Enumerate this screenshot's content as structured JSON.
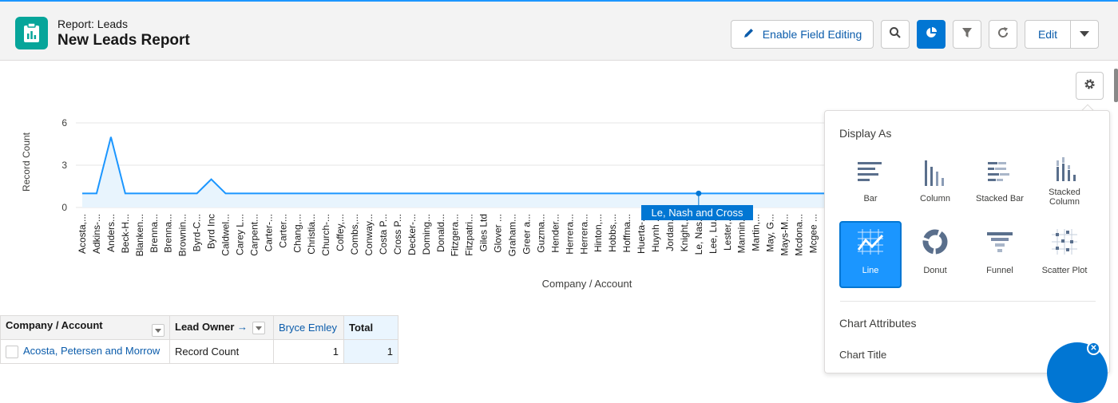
{
  "header": {
    "subtitle": "Report: Leads",
    "title": "New Leads Report",
    "enable_field_editing": "Enable Field Editing",
    "edit": "Edit"
  },
  "chart_data": {
    "type": "line",
    "xlabel": "Company / Account",
    "ylabel": "Record Count",
    "ylim": [
      0,
      6
    ],
    "yticks": [
      0,
      3,
      6
    ],
    "categories": [
      "Acosta,...",
      "Adkins-...",
      "Anders...",
      "Beck-H...",
      "Blanken...",
      "Brenna...",
      "Brenna...",
      "Brownin...",
      "Byrd-C...",
      "Byrd Inc",
      "Caldwel...",
      "Carey L...",
      "Carpent...",
      "Carter-...",
      "Carter...",
      "Chang,...",
      "Christia...",
      "Church-...",
      "Coffey,...",
      "Combs,...",
      "Conway...",
      "Costa P...",
      "Cross P...",
      "Decker-...",
      "Doming...",
      "Donald...",
      "Fitzgera...",
      "Fitzpatri...",
      "Giles Ltd",
      "Glover ...",
      "Graham...",
      "Greer a...",
      "Guzma...",
      "Hender...",
      "Herrera...",
      "Herrera...",
      "Hinton,...",
      "Hobbs,...",
      "Hoffma...",
      "Huerta-...",
      "Huynh ...",
      "Jordan...",
      "Knight,...",
      "Le, Nas...",
      "Lee, Lu...",
      "Lester,...",
      "Mannin...",
      "Martin,...",
      "May, G...",
      "Mays-M...",
      "Mcdona...",
      "Mcgee ..."
    ],
    "values": [
      1,
      1,
      5,
      1,
      1,
      1,
      1,
      1,
      1,
      2,
      1,
      1,
      1,
      1,
      1,
      1,
      1,
      1,
      1,
      1,
      1,
      1,
      1,
      1,
      1,
      1,
      1,
      1,
      1,
      1,
      1,
      1,
      1,
      1,
      1,
      1,
      1,
      1,
      1,
      1,
      1,
      1,
      1,
      1,
      1,
      1,
      1,
      1,
      1,
      1,
      1,
      1
    ],
    "highlight_index": 43,
    "tooltip": "Le, Nash and Cross",
    "color": "#1b96ff",
    "grid": true
  },
  "table": {
    "headers": [
      "Company / Account",
      "Lead Owner",
      "Bryce Emley",
      "Total"
    ],
    "row": {
      "company": "Acosta, Petersen and Morrow",
      "metric": "Record Count",
      "value": "1",
      "total": "1"
    }
  },
  "panel": {
    "display_as": "Display As",
    "options": [
      {
        "label": "Bar",
        "icon": "bar-chart-icon",
        "selected": false
      },
      {
        "label": "Column",
        "icon": "column-chart-icon",
        "selected": false
      },
      {
        "label": "Stacked Bar",
        "icon": "stacked-bar-icon",
        "selected": false
      },
      {
        "label": "Stacked Column",
        "icon": "stacked-column-icon",
        "selected": false
      },
      {
        "label": "Line",
        "icon": "line-chart-icon",
        "selected": true
      },
      {
        "label": "Donut",
        "icon": "donut-chart-icon",
        "selected": false
      },
      {
        "label": "Funnel",
        "icon": "funnel-chart-icon",
        "selected": false
      },
      {
        "label": "Scatter Plot",
        "icon": "scatter-plot-icon",
        "selected": false
      }
    ],
    "chart_attributes": "Chart Attributes",
    "chart_title_label": "Chart Title"
  },
  "colors": {
    "accent": "#0176d3",
    "app_icon": "#06a59a",
    "link": "#0b5cab"
  }
}
